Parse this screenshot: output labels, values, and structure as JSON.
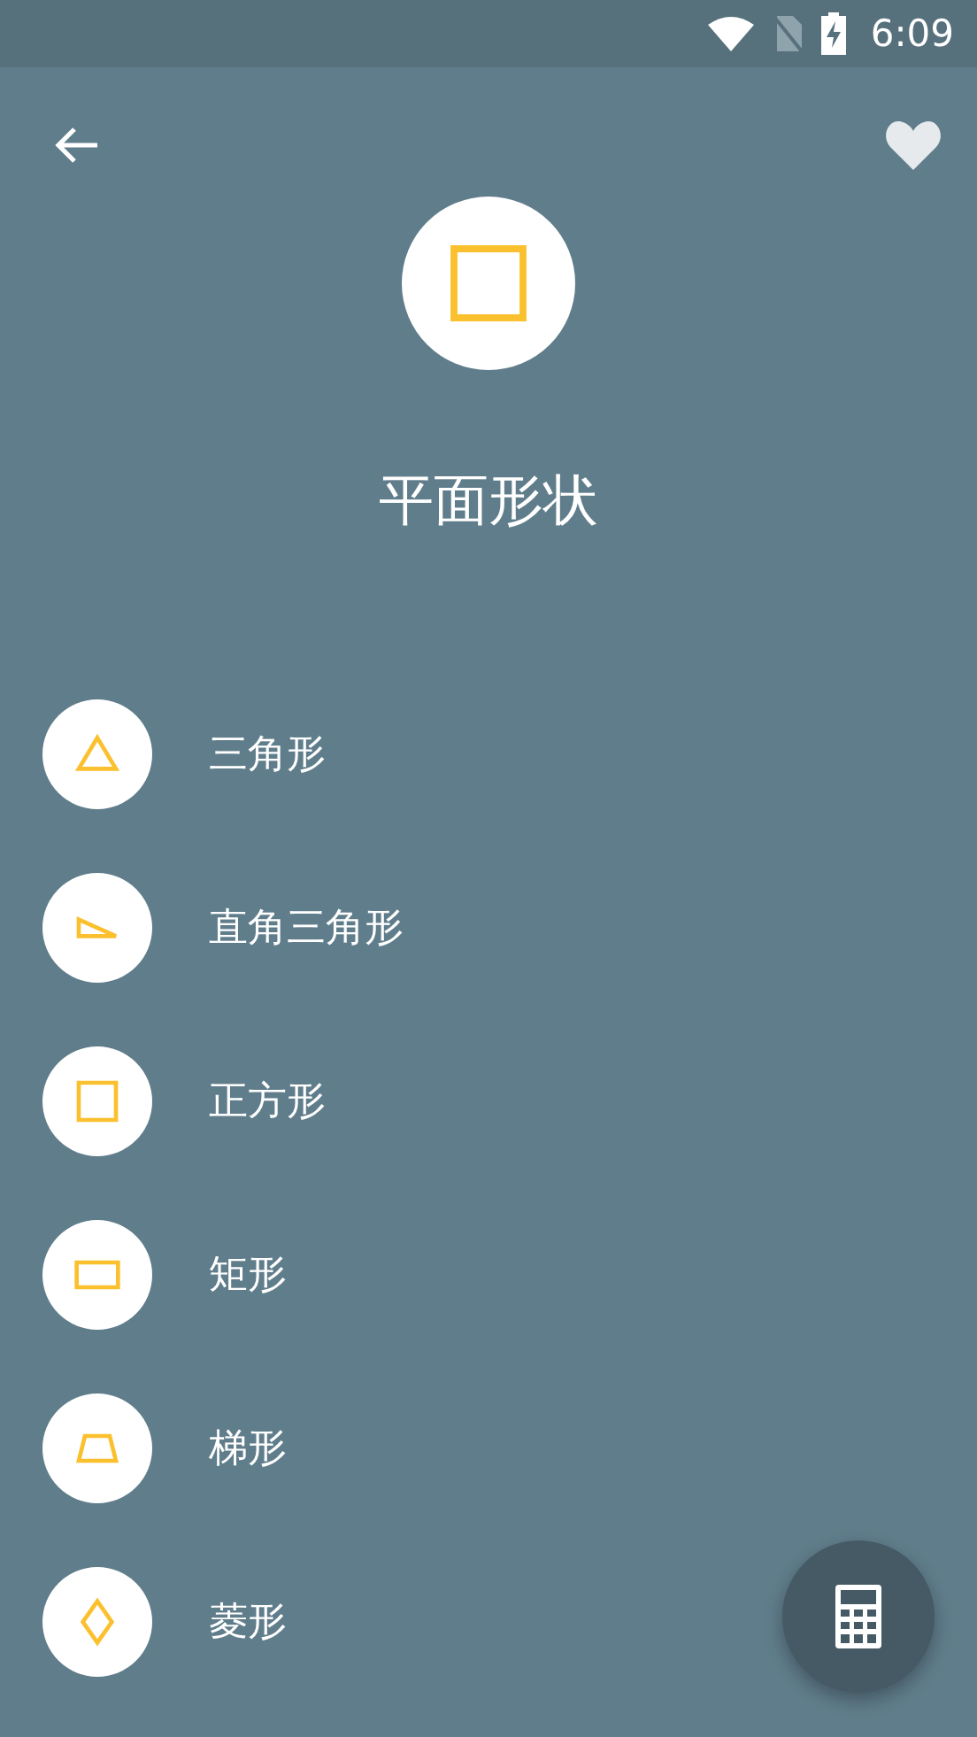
{
  "status_bar": {
    "time": "6:09"
  },
  "header": {
    "title": "平面形状",
    "kind": "square"
  },
  "shapes": [
    {
      "label": "三角形",
      "kind": "triangle"
    },
    {
      "label": "直角三角形",
      "kind": "right-triangle"
    },
    {
      "label": "正方形",
      "kind": "square"
    },
    {
      "label": "矩形",
      "kind": "rectangle"
    },
    {
      "label": "梯形",
      "kind": "trapezoid"
    },
    {
      "label": "菱形",
      "kind": "rhombus"
    }
  ]
}
